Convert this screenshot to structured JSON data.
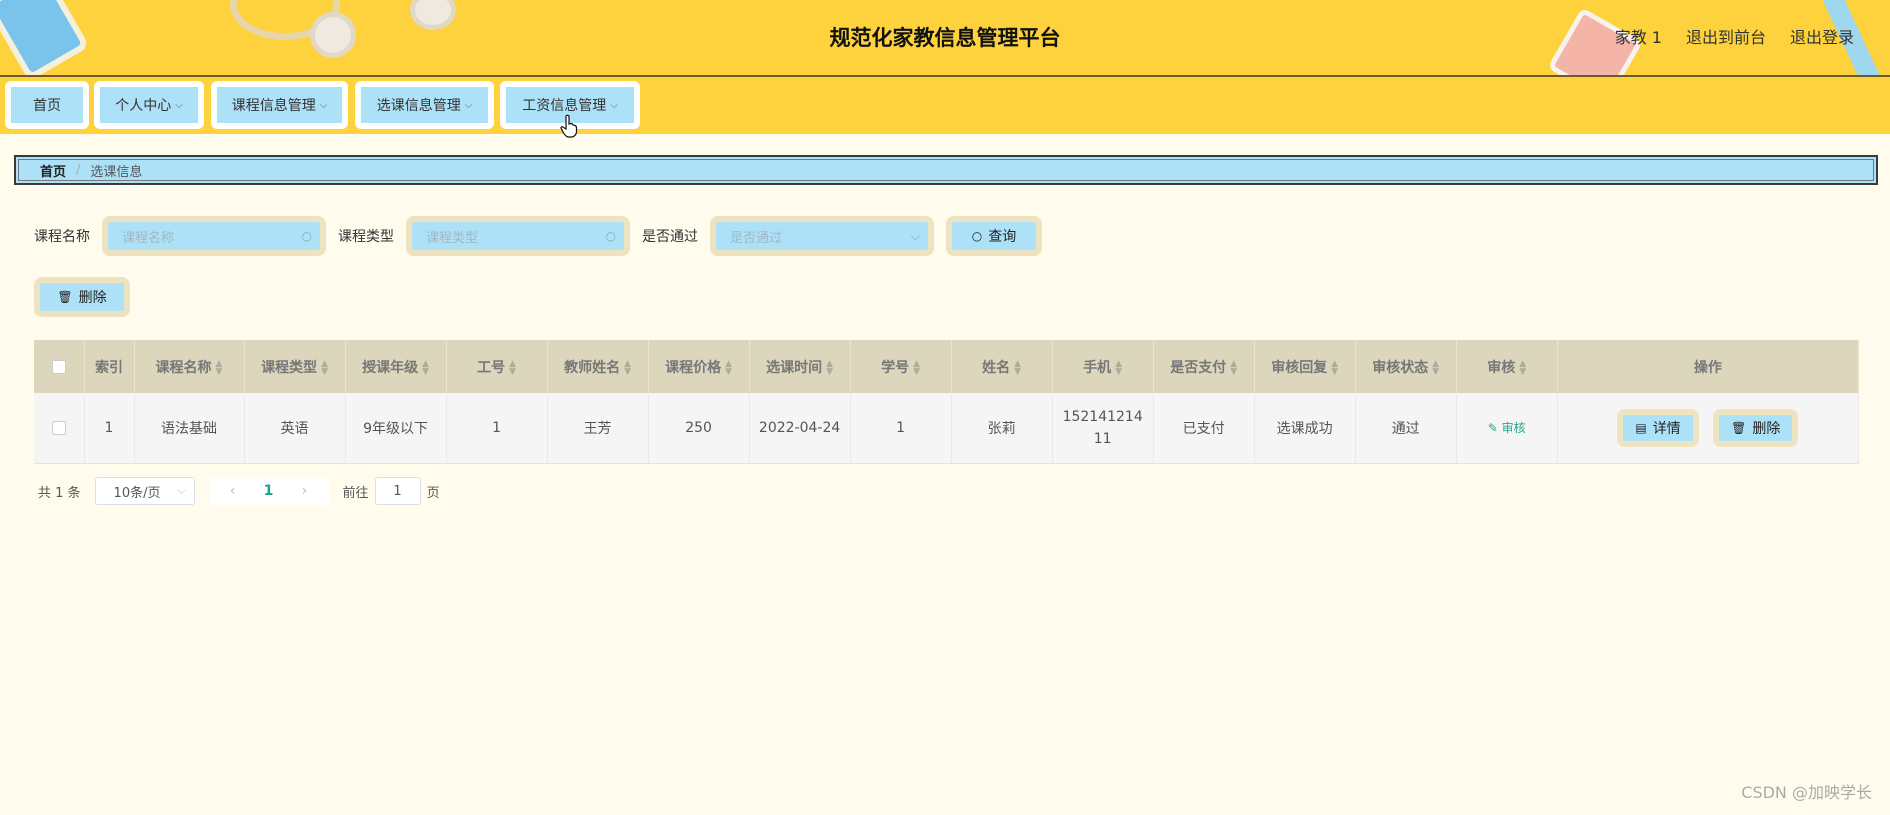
{
  "header": {
    "title": "规范化家教信息管理平台",
    "user": "家教 1",
    "to_front": "退出到前台",
    "logout": "退出登录"
  },
  "nav": [
    {
      "label": "首页",
      "has_dropdown": false
    },
    {
      "label": "个人中心",
      "has_dropdown": true
    },
    {
      "label": "课程信息管理",
      "has_dropdown": true
    },
    {
      "label": "选课信息管理",
      "has_dropdown": true
    },
    {
      "label": "工资信息管理",
      "has_dropdown": true
    }
  ],
  "breadcrumb": {
    "home": "首页",
    "sep": "/",
    "current": "选课信息"
  },
  "search": {
    "course_name_label": "课程名称",
    "course_name_placeholder": "课程名称",
    "course_type_label": "课程类型",
    "course_type_placeholder": "课程类型",
    "passed_label": "是否通过",
    "passed_placeholder": "是否通过",
    "query_label": "查询"
  },
  "toolbar": {
    "delete_label": "删除"
  },
  "table": {
    "headers": [
      "索引",
      "课程名称",
      "课程类型",
      "授课年级",
      "工号",
      "教师姓名",
      "课程价格",
      "选课时间",
      "学号",
      "姓名",
      "手机",
      "是否支付",
      "审核回复",
      "审核状态",
      "审核",
      "操作"
    ],
    "rows": [
      {
        "index": "1",
        "course_name": "语法基础",
        "course_type": "英语",
        "grade": "9年级以下",
        "teacher_id": "1",
        "teacher_name": "王芳",
        "price": "250",
        "select_time": "2022-04-24",
        "student_id": "1",
        "name": "张莉",
        "phone_line1": "152141214",
        "phone_line2": "11",
        "paid": "已支付",
        "reply": "选课成功",
        "status": "通过",
        "audit": "审核",
        "detail": "详情",
        "delete": "删除"
      }
    ]
  },
  "pagination": {
    "total": "共 1 条",
    "page_size": "10条/页",
    "current_page": "1",
    "goto_prefix": "前往",
    "goto_value": "1",
    "goto_suffix": "页"
  },
  "watermark": "CSDN @加映学长",
  "colors": {
    "header_bg": "#fdd23c",
    "button_bg": "#ade1f7",
    "page_bg": "#fffcee",
    "table_header_bg": "#dcd6bc"
  }
}
